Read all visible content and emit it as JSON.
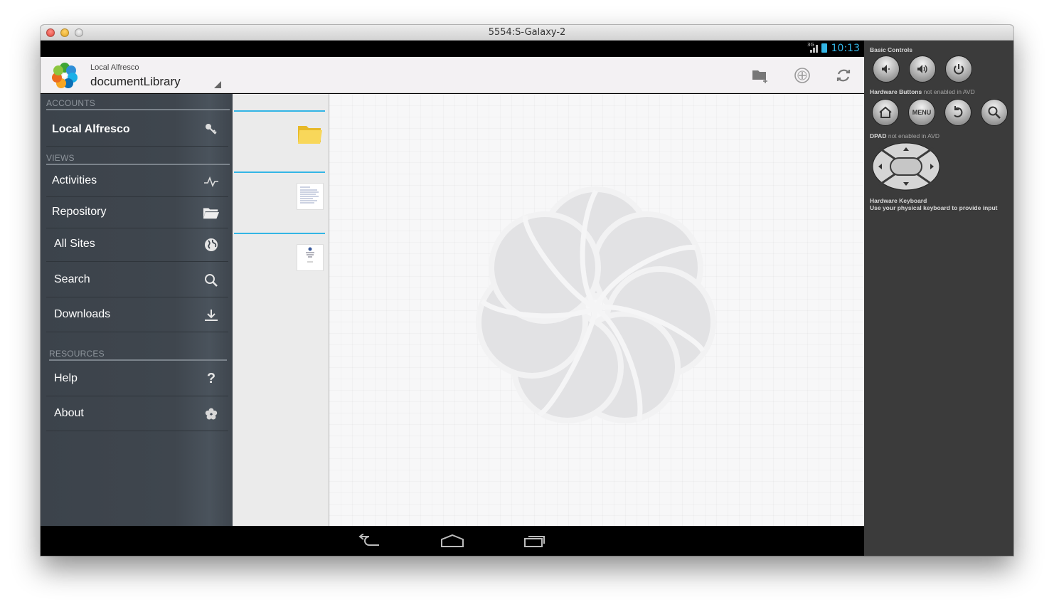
{
  "window": {
    "title": "5554:S-Galaxy-2"
  },
  "statusbar": {
    "network": "3G",
    "time": "10:13"
  },
  "actionbar": {
    "account": "Local Alfresco",
    "title": "documentLibrary"
  },
  "drawer": {
    "sections": {
      "accounts": "ACCOUNTS",
      "views": "VIEWS",
      "resources": "RESOURCES"
    },
    "account_item": "Local Alfresco",
    "views": [
      {
        "label": "Activities",
        "icon": "activity-icon"
      },
      {
        "label": "Repository",
        "icon": "folder-open-icon"
      },
      {
        "label": "All Sites",
        "icon": "globe-icon"
      },
      {
        "label": "Search",
        "icon": "search-icon"
      },
      {
        "label": "Downloads",
        "icon": "download-icon"
      }
    ],
    "resources": [
      {
        "label": "Help",
        "icon": "help-icon"
      },
      {
        "label": "About",
        "icon": "alfresco-flower-icon"
      }
    ]
  },
  "list": {
    "items": [
      {
        "type": "folder",
        "icon": "folder-icon"
      },
      {
        "type": "document",
        "icon": "document-thumbnail"
      },
      {
        "type": "document",
        "icon": "document-thumbnail"
      }
    ]
  },
  "panel": {
    "basic_controls": "Basic Controls",
    "hw_buttons": "Hardware Buttons",
    "hw_buttons_note": "not enabled in AVD",
    "menu_label": "MENU",
    "dpad": "DPAD",
    "dpad_note": "not enabled in AVD",
    "keyboard_title": "Hardware Keyboard",
    "keyboard_note": "Use your physical keyboard to provide input"
  },
  "colors": {
    "accent": "#33b5e5",
    "drawer_bg": "#3f464e",
    "panel_bg": "#3b3b3b"
  }
}
